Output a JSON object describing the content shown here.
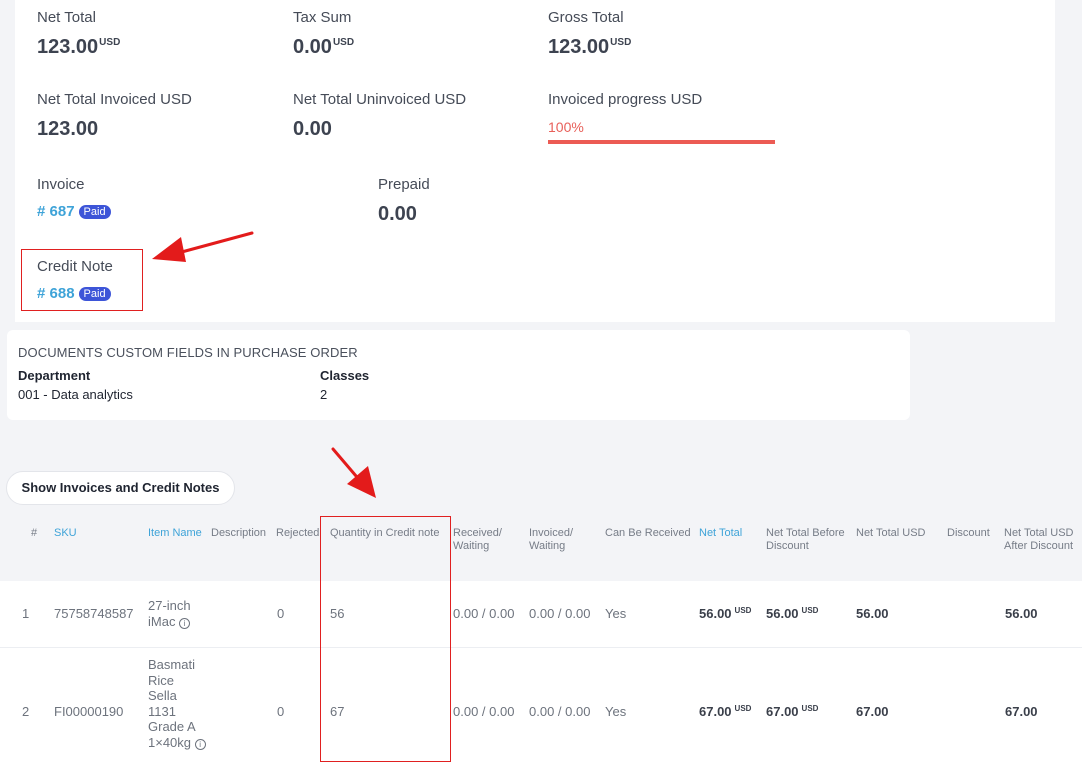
{
  "summary": {
    "net_total_label": "Net Total",
    "net_total_value": "123.00",
    "net_total_currency": "USD",
    "tax_sum_label": "Tax Sum",
    "tax_sum_value": "0.00",
    "tax_sum_currency": "USD",
    "gross_total_label": "Gross Total",
    "gross_total_value": "123.00",
    "gross_total_currency": "USD",
    "net_invoiced_label": "Net Total Invoiced USD",
    "net_invoiced_value": "123.00",
    "net_uninvoiced_label": "Net Total Uninvoiced USD",
    "net_uninvoiced_value": "0.00",
    "invoiced_progress_label": "Invoiced progress USD",
    "invoiced_progress_text": "100%",
    "invoiced_progress_fraction": 1.0,
    "invoice_label": "Invoice",
    "invoice_number": "# 687",
    "invoice_status": "Paid",
    "prepaid_label": "Prepaid",
    "prepaid_value": "0.00",
    "credit_note_label": "Credit Note",
    "credit_note_number": "# 688",
    "credit_note_status": "Paid"
  },
  "custom_fields": {
    "title": "DOCUMENTS CUSTOM FIELDS IN PURCHASE ORDER",
    "department_label": "Department",
    "department_value": "001 - Data analytics",
    "classes_label": "Classes",
    "classes_value": "2"
  },
  "show_button_label": "Show Invoices and Credit Notes",
  "table": {
    "headers": {
      "num": "#",
      "sku": "SKU",
      "item_name": "Item Name",
      "description": "Description",
      "rejected": "Rejected",
      "qty_credit_note": "Quantity in Credit note",
      "received": "Received/ Waiting",
      "invoiced": "Invoiced/ Waiting",
      "can_be_received": "Can Be Received",
      "net_total": "Net Total",
      "net_total_before_discount": "Net Total Before Discount",
      "net_total_usd": "Net Total USD",
      "discount": "Discount",
      "net_total_usd_after_discount": "Net Total USD After Discount"
    },
    "rows": [
      {
        "num": "1",
        "sku": "75758748587",
        "item_name": "27-inch iMac",
        "rejected": "0",
        "qty_credit_note": "56",
        "received": "0.00 / 0.00",
        "invoiced": "0.00 / 0.00",
        "can_be_received": "Yes",
        "net_total": "56.00",
        "net_total_currency": "USD",
        "net_total_before_discount": "56.00",
        "net_total_before_discount_currency": "USD",
        "net_total_usd": "56.00",
        "net_total_usd_after_discount": "56.00"
      },
      {
        "num": "2",
        "sku": "FI00000190",
        "item_name": "Basmati Rice Sella 1131 Grade A 1×40kg",
        "rejected": "0",
        "qty_credit_note": "67",
        "received": "0.00 / 0.00",
        "invoiced": "0.00 / 0.00",
        "can_be_received": "Yes",
        "net_total": "67.00",
        "net_total_currency": "USD",
        "net_total_before_discount": "67.00",
        "net_total_before_discount_currency": "USD",
        "net_total_usd": "67.00",
        "net_total_usd_after_discount": "67.00"
      }
    ]
  },
  "colors": {
    "link": "#3ea3d8",
    "badge": "#3d55d8",
    "progress": "#ec5b54",
    "highlight": "#e02020"
  },
  "icons": [
    "info-icon",
    "annotation-arrow-icon"
  ]
}
